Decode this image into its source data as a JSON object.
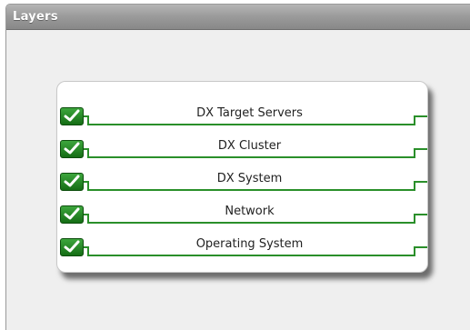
{
  "panel": {
    "title": "Layers"
  },
  "layers": [
    {
      "label": "DX Target Servers",
      "checked": true
    },
    {
      "label": "DX Cluster",
      "checked": true
    },
    {
      "label": "DX System",
      "checked": true
    },
    {
      "label": "Network",
      "checked": true
    },
    {
      "label": "Operating System",
      "checked": true
    }
  ],
  "colors": {
    "accent_green": "#2a8f2a",
    "title_bar": "#9c9c9c",
    "panel_bg": "#efefef"
  }
}
